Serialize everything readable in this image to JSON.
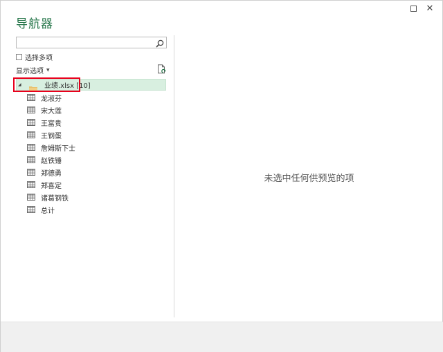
{
  "window": {
    "title": "导航器",
    "maximize_icon": "maximize-icon",
    "close_icon": "close-icon",
    "close_glyph": "✕"
  },
  "left_panel": {
    "search": {
      "value": "",
      "placeholder": ""
    },
    "multi_select_label": "选择多项",
    "display_options_label": "显示选项",
    "display_options_caret": "▼",
    "tree": {
      "root": {
        "label": "业绩.xlsx [10]",
        "expand_glyph": "◢"
      },
      "items": [
        "龙淑芬",
        "宋大莲",
        "王富贵",
        "王钢蛋",
        "詹姆斯下士",
        "赵铁锤",
        "郑德勇",
        "郑喜定",
        "诸葛钢铁",
        "总计"
      ]
    }
  },
  "right_panel": {
    "empty_message": "未选中任何供预览的项"
  },
  "colors": {
    "title_green": "#217346",
    "root_selected_bg": "#d8efe0",
    "highlight_red": "#e8001c",
    "folder_yellow": "#e8c16f",
    "footer_bg": "#f0f0f0"
  }
}
